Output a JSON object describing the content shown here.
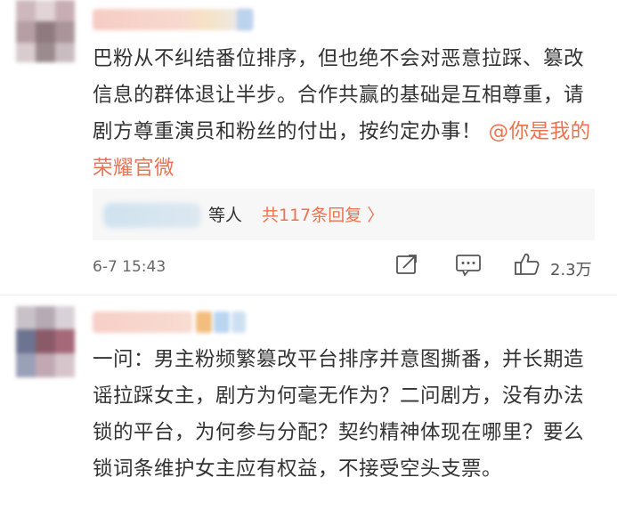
{
  "comments": [
    {
      "text_main": "巴粉从不纠结番位排序，但也绝不会对恶意拉踩、篡改信息的群体退让半步。合作共赢的基础是互相尊重，请剧方尊重演员和粉丝的付出，按约定办事！",
      "mention": "@你是我的荣耀官微",
      "reply": {
        "suffix": "等人",
        "count_text": "共117条回复 〉"
      },
      "time": "6-7 15:43",
      "likes": "2.3万",
      "icons": [
        "share-icon",
        "comment-icon",
        "like-icon"
      ]
    },
    {
      "text_main": "一问：男主粉频繁篡改平台排序并意图撕番，并长期造谣拉踩女主，剧方为何毫无作为？二问剧方，没有办法锁的平台，为何参与分配？契约精神体现在哪里？要么锁词条维护女主应有权益，不接受空头支票。"
    }
  ],
  "colors": {
    "accent": "#eb7350",
    "text": "#333333",
    "meta": "#666666",
    "reply_bg": "#f7f7f7"
  }
}
